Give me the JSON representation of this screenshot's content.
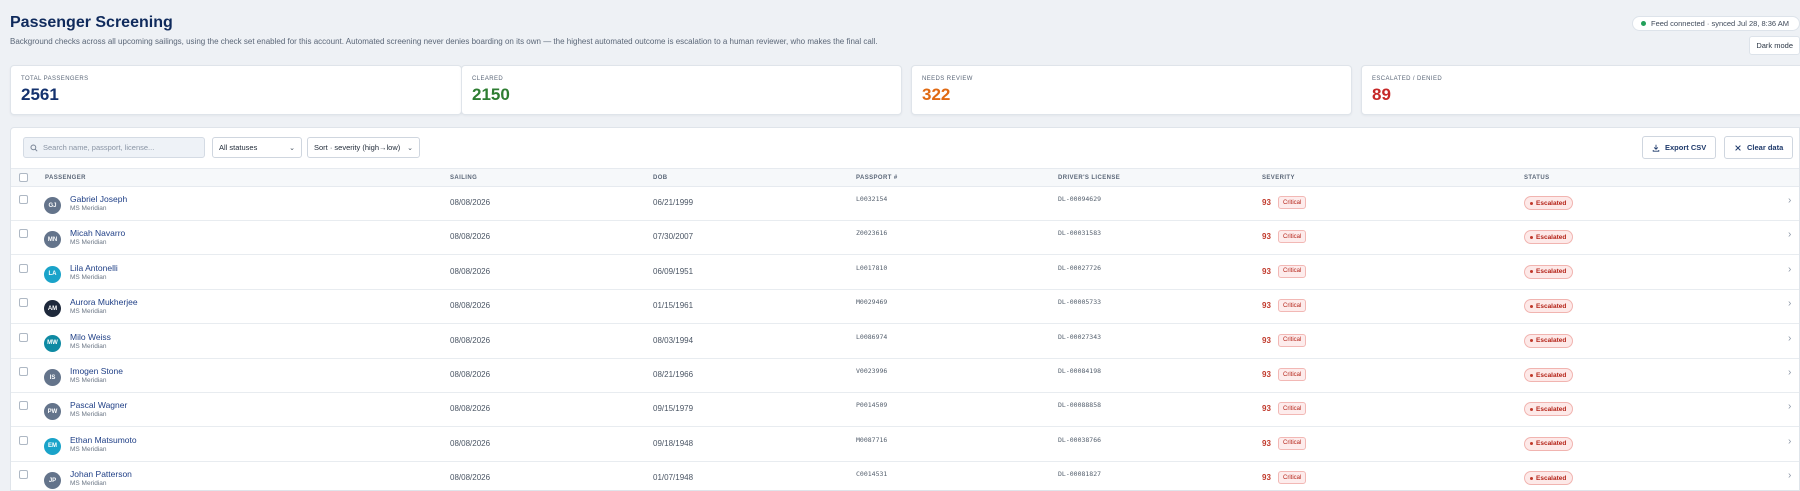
{
  "header": {
    "title": "Passenger Screening",
    "subtitle": "Background checks across all upcoming sailings, using the check set enabled for this account. Automated screening never denies boarding on its own — the highest automated outcome is escalation to a human reviewer, who makes the final call.",
    "sync_status": "Feed connected · synced Jul 28, 8:36 AM",
    "dark_mode_label": "Dark mode"
  },
  "stats": [
    {
      "label": "TOTAL PASSENGERS",
      "value": "2561",
      "color": "#14326e"
    },
    {
      "label": "CLEARED",
      "value": "2150",
      "color": "#2e7d32"
    },
    {
      "label": "NEEDS REVIEW",
      "value": "322",
      "color": "#e06a13"
    },
    {
      "label": "ESCALATED / DENIED",
      "value": "89",
      "color": "#c62828"
    }
  ],
  "toolbar": {
    "search_placeholder": "Search name, passport, license...",
    "status_filter": "All statuses",
    "sort": "Sort · severity (high→low)",
    "export_label": "Export CSV",
    "clear_label": "Clear data"
  },
  "columns": [
    "PASSENGER",
    "SAILING",
    "DOB",
    "PASSPORT #",
    "DRIVER'S LICENSE",
    "SEVERITY",
    "STATUS"
  ],
  "rows": [
    {
      "initials": "GJ",
      "avatar_color": "#64748b",
      "name": "Gabriel Joseph",
      "ship": "MS Meridian",
      "sailing": "08/08/2026",
      "dob": "06/21/1999",
      "passport": "L0032154",
      "license": "DL-00094629",
      "severity": "93",
      "severity_label": "Critical",
      "status": "Escalated"
    },
    {
      "initials": "MN",
      "avatar_color": "#64748b",
      "name": "Micah Navarro",
      "ship": "MS Meridian",
      "sailing": "08/08/2026",
      "dob": "07/30/2007",
      "passport": "Z0023616",
      "license": "DL-00031583",
      "severity": "93",
      "severity_label": "Critical",
      "status": "Escalated"
    },
    {
      "initials": "LA",
      "avatar_color": "#1aa3c9",
      "name": "Lila Antonelli",
      "ship": "MS Meridian",
      "sailing": "08/08/2026",
      "dob": "06/09/1951",
      "passport": "L0017810",
      "license": "DL-00027726",
      "severity": "93",
      "severity_label": "Critical",
      "status": "Escalated"
    },
    {
      "initials": "AM",
      "avatar_color": "#1e293b",
      "name": "Aurora Mukherjee",
      "ship": "MS Meridian",
      "sailing": "08/08/2026",
      "dob": "01/15/1961",
      "passport": "M0029469",
      "license": "DL-00005733",
      "severity": "93",
      "severity_label": "Critical",
      "status": "Escalated"
    },
    {
      "initials": "MW",
      "avatar_color": "#0e8aa3",
      "name": "Milo Weiss",
      "ship": "MS Meridian",
      "sailing": "08/08/2026",
      "dob": "08/03/1994",
      "passport": "L0086974",
      "license": "DL-00027343",
      "severity": "93",
      "severity_label": "Critical",
      "status": "Escalated"
    },
    {
      "initials": "IS",
      "avatar_color": "#64748b",
      "name": "Imogen Stone",
      "ship": "MS Meridian",
      "sailing": "08/08/2026",
      "dob": "08/21/1966",
      "passport": "V0023996",
      "license": "DL-00084198",
      "severity": "93",
      "severity_label": "Critical",
      "status": "Escalated"
    },
    {
      "initials": "PW",
      "avatar_color": "#64748b",
      "name": "Pascal Wagner",
      "ship": "MS Meridian",
      "sailing": "08/08/2026",
      "dob": "09/15/1979",
      "passport": "P0014509",
      "license": "DL-00088858",
      "severity": "93",
      "severity_label": "Critical",
      "status": "Escalated"
    },
    {
      "initials": "EM",
      "avatar_color": "#1aa3c9",
      "name": "Ethan Matsumoto",
      "ship": "MS Meridian",
      "sailing": "08/08/2026",
      "dob": "09/18/1948",
      "passport": "M0087716",
      "license": "DL-00038766",
      "severity": "93",
      "severity_label": "Critical",
      "status": "Escalated"
    },
    {
      "initials": "JP",
      "avatar_color": "#64748b",
      "name": "Johan Patterson",
      "ship": "MS Meridian",
      "sailing": "08/08/2026",
      "dob": "01/07/1948",
      "passport": "C0014531",
      "license": "DL-00081827",
      "severity": "93",
      "severity_label": "Critical",
      "status": "Escalated"
    }
  ]
}
